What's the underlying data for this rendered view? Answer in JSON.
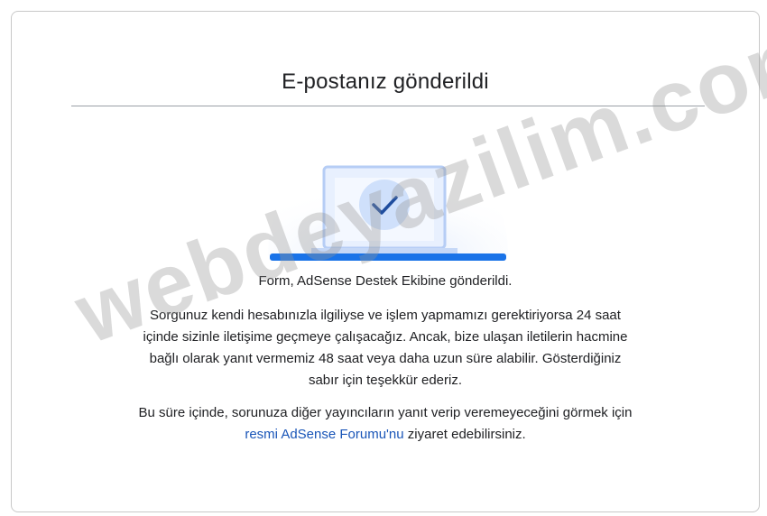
{
  "dialog": {
    "title": "E-postanız gönderildi",
    "message_sent": "Form, AdSense Destek Ekibine gönderildi.",
    "message_response": "Sorgunuz kendi hesabınızla ilgiliyse ve işlem yapmamızı gerektiriyorsa 24 saat içinde sizinle iletişime geçmeye çalışacağız. Ancak, bize ulaşan iletilerin hacmine bağlı olarak yanıt vermemiz 48 saat veya daha uzun süre alabilir. Gösterdiğiniz sabır için teşekkür ederiz.",
    "message_forum_before": "Bu süre içinde, sorunuza diğer yayıncıların yanıt verip veremeyeceğini görmek için ",
    "forum_link": "resmi AdSense Forumu'nu",
    "message_forum_after": " ziyaret edebilirsiniz.",
    "illustration_icon": "laptop-check-icon"
  },
  "watermark": {
    "text": "webdeyazilim.com"
  },
  "colors": {
    "accent_blue": "#1a73e8",
    "link_blue": "#1a56b8",
    "text": "#202124"
  }
}
